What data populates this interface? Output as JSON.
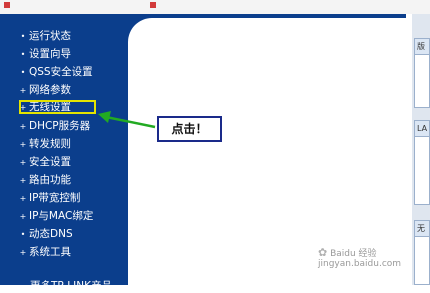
{
  "sidebar": {
    "items": [
      {
        "label": "运行状态",
        "bullet": "•"
      },
      {
        "label": "设置向导",
        "bullet": "•"
      },
      {
        "label": "QSS安全设置",
        "bullet": "•"
      },
      {
        "label": "网络参数",
        "bullet": "+"
      },
      {
        "label": "无线设置",
        "bullet": "+"
      },
      {
        "label": "DHCP服务器",
        "bullet": "+"
      },
      {
        "label": "转发规则",
        "bullet": "+"
      },
      {
        "label": "安全设置",
        "bullet": "+"
      },
      {
        "label": "路由功能",
        "bullet": "+"
      },
      {
        "label": "IP带宽控制",
        "bullet": "+"
      },
      {
        "label": "IP与MAC绑定",
        "bullet": "+"
      },
      {
        "label": "动态DNS",
        "bullet": "•"
      },
      {
        "label": "系统工具",
        "bullet": "+"
      }
    ],
    "bottom_label": "更多TP-LINK产品，"
  },
  "annotation": {
    "callout_text": "点击！",
    "highlight_color": "#e4e400",
    "arrow_color": "#22aa22"
  },
  "right_panel": {
    "box1_header": "版",
    "box2_header": "LA",
    "box3_header": "无"
  },
  "watermark": {
    "text": "Baidu 经验",
    "url": "jingyan.baidu.com"
  },
  "colors": {
    "nav_bg": "#0b3e8c",
    "nav_text": "#ffffff",
    "callout_border": "#1a2a8a"
  }
}
